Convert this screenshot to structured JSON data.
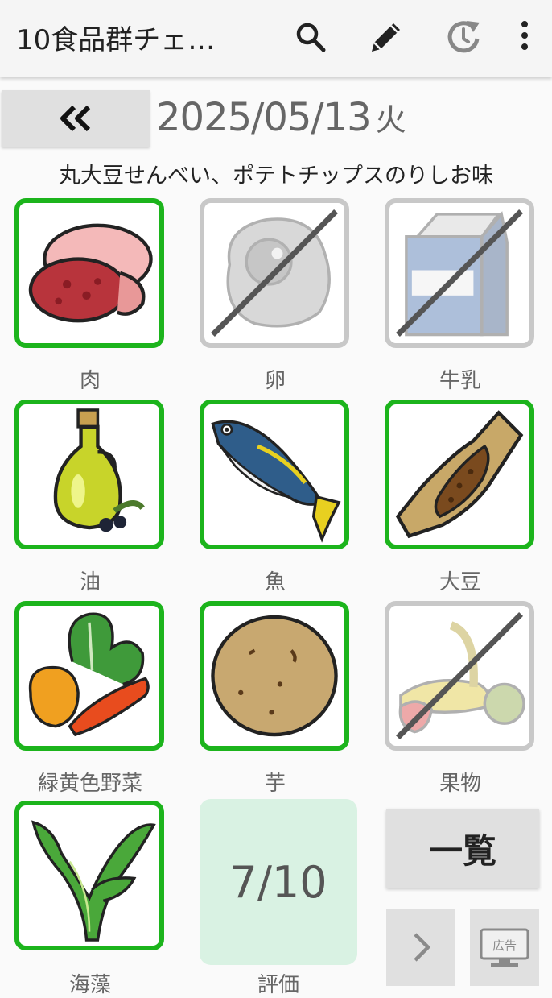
{
  "app": {
    "title": "10食品群チェ…"
  },
  "toolbar": {
    "search": "search-icon",
    "edit": "pencil-icon",
    "history": "history-icon",
    "more": "more-vert-icon"
  },
  "date": {
    "text": "2025/05/13",
    "weekday": "火"
  },
  "memo": "丸大豆せんべい、ポテトチップスのりしお味",
  "foods": [
    {
      "label": "肉",
      "checked": true
    },
    {
      "label": "卵",
      "checked": false
    },
    {
      "label": "牛乳",
      "checked": false
    },
    {
      "label": "油",
      "checked": true
    },
    {
      "label": "魚",
      "checked": true
    },
    {
      "label": "大豆",
      "checked": true
    },
    {
      "label": "緑黄色野菜",
      "checked": true
    },
    {
      "label": "芋",
      "checked": true
    },
    {
      "label": "果物",
      "checked": false
    },
    {
      "label": "海藻",
      "checked": true
    }
  ],
  "score": {
    "value": "7/10",
    "label": "評価"
  },
  "list_button": "一覧",
  "ad_badge": "広告",
  "colors": {
    "checked_border": "#1cb41c",
    "unchecked_border": "#c8c8c8",
    "score_bg": "#d9f2e3"
  }
}
